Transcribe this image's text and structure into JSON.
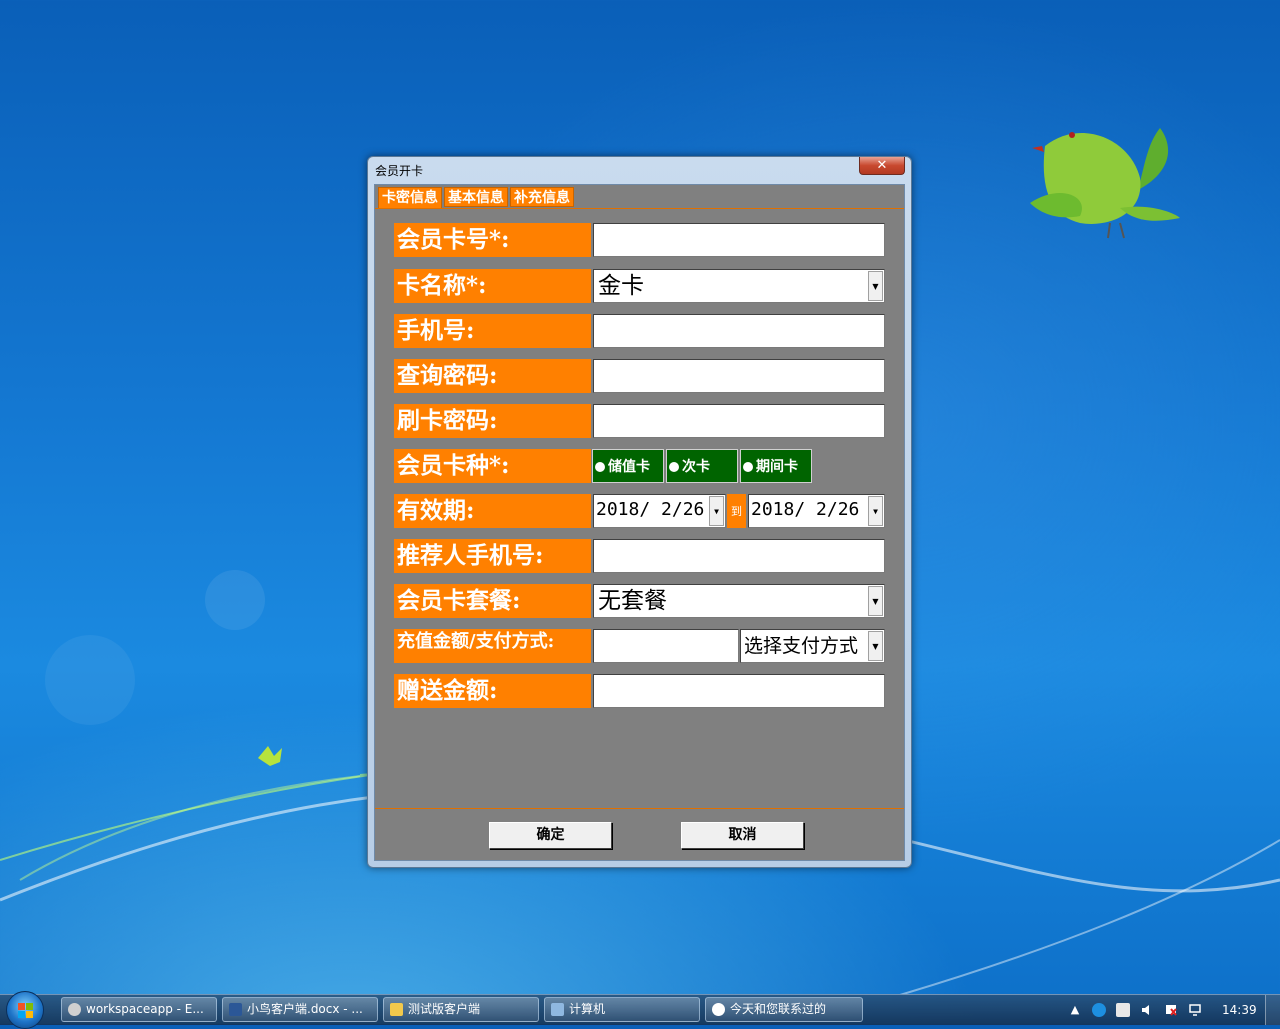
{
  "window": {
    "title": "会员开卡",
    "close_symbol": "✕"
  },
  "tabs": [
    {
      "label": "卡密信息",
      "active": true
    },
    {
      "label": "基本信息",
      "active": false
    },
    {
      "label": "补充信息",
      "active": false
    }
  ],
  "form": {
    "card_number": {
      "label": "会员卡号*:",
      "value": ""
    },
    "card_name": {
      "label": "卡名称*:",
      "value": "金卡"
    },
    "phone": {
      "label": "手机号:",
      "value": ""
    },
    "query_password": {
      "label": "查询密码:",
      "value": ""
    },
    "swipe_password": {
      "label": "刷卡密码:",
      "value": ""
    },
    "card_type": {
      "label": "会员卡种*:",
      "options": [
        "储值卡",
        "次卡",
        "期间卡"
      ]
    },
    "validity": {
      "label": "有效期:",
      "from": "2018/ 2/26",
      "to_label": "到",
      "to": "2018/ 2/26"
    },
    "referrer_phone": {
      "label": "推荐人手机号:",
      "value": ""
    },
    "package": {
      "label": "会员卡套餐:",
      "value": "无套餐"
    },
    "recharge": {
      "label": "充值金额/支付方式:",
      "amount": "",
      "payment_method": "选择支付方式"
    },
    "gift_amount": {
      "label": "赠送金额:",
      "value": ""
    }
  },
  "buttons": {
    "confirm": "确定",
    "cancel": "取消"
  },
  "taskbar": {
    "items": [
      {
        "label": "workspaceapp - E...",
        "icon": "gear-icon"
      },
      {
        "label": "小鸟客户端.docx - ...",
        "icon": "word-doc-icon"
      },
      {
        "label": "测试版客户端",
        "icon": "folder-icon"
      },
      {
        "label": "计算机",
        "icon": "computer-icon"
      },
      {
        "label": "今天和您联系过的",
        "icon": "qq-icon"
      }
    ],
    "tray_arrow": "▲",
    "clock": "14:39"
  },
  "colors": {
    "label_orange": "#ff8000",
    "radio_green": "#006400",
    "client_gray": "#808080"
  }
}
